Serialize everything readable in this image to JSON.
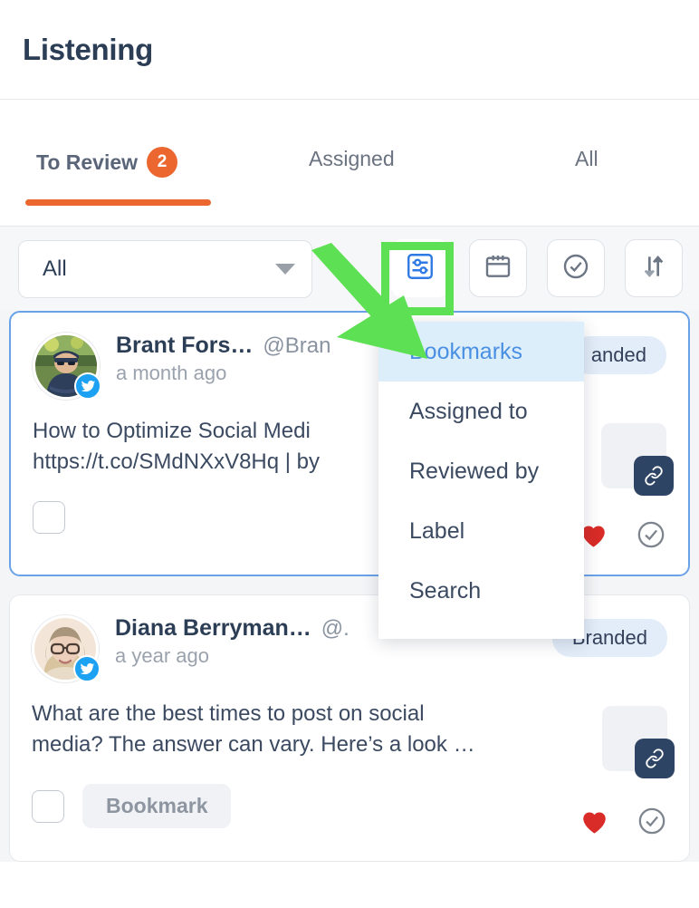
{
  "header": {
    "title": "Listening"
  },
  "tabs": [
    {
      "label": "To Review",
      "badge": "2",
      "active": true
    },
    {
      "label": "Assigned",
      "badge": "",
      "active": false
    },
    {
      "label": "All",
      "badge": "",
      "active": false
    }
  ],
  "filterbar": {
    "select_value": "All",
    "tools": [
      {
        "name": "filter-sliders-icon",
        "label": "Filter"
      },
      {
        "name": "calendar-icon",
        "label": "Date range"
      },
      {
        "name": "check-circle-icon",
        "label": "Reviewed"
      },
      {
        "name": "sort-arrows-icon",
        "label": "Sort"
      }
    ]
  },
  "dropdown": {
    "items": [
      {
        "label": "Bookmarks",
        "active": true
      },
      {
        "label": "Assigned to",
        "active": false
      },
      {
        "label": "Reviewed by",
        "active": false
      },
      {
        "label": "Label",
        "active": false
      },
      {
        "label": "Search",
        "active": false
      }
    ]
  },
  "posts": [
    {
      "author": "Brant Fors…",
      "handle": "@Bran",
      "time": "a month ago",
      "badge": "anded",
      "text_line1": "How to Optimize Social Medi",
      "text_line2": "https://t.co/SMdNXxV8Hq | by",
      "bookmark_label": "",
      "liked": true,
      "selected": true,
      "network": "twitter-icon"
    },
    {
      "author": "Diana Berryman…",
      "handle": "@.",
      "time": "a year ago",
      "badge": "Branded",
      "text_line1": "What are the best times to post on social",
      "text_line2": "media? The answer can vary. Here’s a look …",
      "bookmark_label": "Bookmark",
      "liked": true,
      "selected": false,
      "network": "twitter-icon"
    }
  ],
  "annotation": {
    "highlight_color": "#5de053",
    "arrow_name": "green-pointer-arrow",
    "box_name": "green-highlight-box"
  },
  "colors": {
    "accent_orange": "#ec6730",
    "text_dark": "#2c3e56",
    "badge_blue_bg": "#e3edf9",
    "heart_red": "#d92b27",
    "selected_border": "#6aa2e8"
  }
}
